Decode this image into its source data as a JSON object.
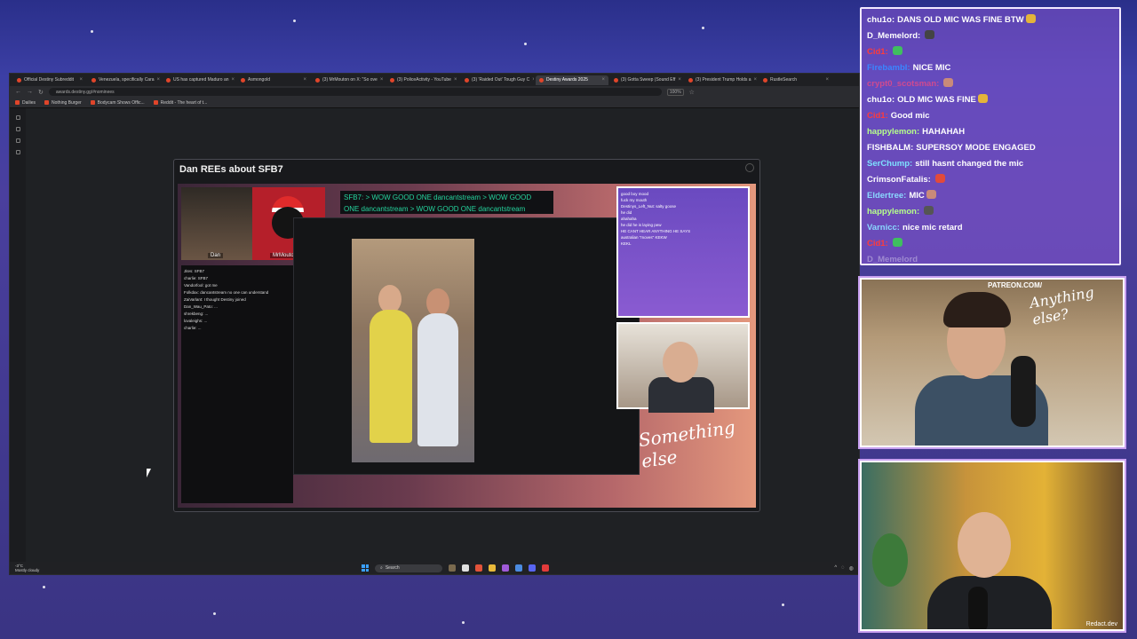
{
  "browser": {
    "tabs": [
      {
        "label": "Official Destiny Subreddit"
      },
      {
        "label": "Venezuela, specifically Cara"
      },
      {
        "label": "US has captured Maduro an"
      },
      {
        "label": "Asmongold"
      },
      {
        "label": "(3) MrMouton on X: \"So ove"
      },
      {
        "label": "(3) PoliceActivity - YouTube"
      },
      {
        "label": "(3) 'Raided Out' Tough Guy C"
      },
      {
        "label": "Destiny Awards 2025",
        "active": true
      },
      {
        "label": "(3) Gotta Sweep (Sound Eff"
      },
      {
        "label": "(3) President Trump Holds a"
      },
      {
        "label": "RustleSearch"
      }
    ],
    "url": "awards.destiny.gg/#nominees",
    "zoom": "100%",
    "bookmarks": [
      "Dailies",
      "Nothing Burger",
      "Bodycam Shows Offic...",
      "Reddit - The heart of t..."
    ]
  },
  "modal": {
    "title": "Dan REEs about SFB7",
    "video": {
      "sfb_text_1": "SFB7: > WOW GOOD ONE dancantstream > WOW GOOD",
      "sfb_text_2": "ONE dancantstream > WOW GOOD ONE dancantstream",
      "cam_label_left": "Dan",
      "cam_label_right": "MrMouton",
      "logo_text": "Something else",
      "left_chat": [
        "Jites: SFB7",
        "charlie: SFB7",
        "Vandorfool: got me",
        "Folkdax: dancantstream no one can understand",
        "ZaiVarlant: I thought Destiny joined",
        "Dan_Wau_Pato: ...",
        "shrekbeng: ...",
        "lovaleighs: ...",
        "charlie: ..."
      ],
      "right_chat": [
        "good boy mood",
        "fuck my mouth",
        "Destinys_Left_Nut: salty goose",
        "he did",
        "ahahaha",
        "he did he is laying pew",
        "HE CANT HEAR ANYTHING HE SAYS",
        "australian \"moves\" KEKW",
        "KEKL"
      ]
    }
  },
  "taskbar": {
    "weather": [
      "-3°C",
      "Mostly cloudy"
    ],
    "search_label": "Search"
  },
  "stream_chat": [
    {
      "user": "chu1o:",
      "message": "DANS OLD MIC WAS FINE BTW",
      "color": "#ffffff",
      "emote": "#e4b43a"
    },
    {
      "user": "D_Memelord:",
      "message": "",
      "color": "#ffffff",
      "emote": "#444444"
    },
    {
      "user": "Cid1:",
      "message": "",
      "color": "#ff3b3b",
      "emote": "#3fbf5f"
    },
    {
      "user": "FirebambI:",
      "message": "NICE MIC",
      "color": "#3a86ff",
      "emote": ""
    },
    {
      "user": "crypt0_scotsman:",
      "message": "",
      "color": "#d04a8f",
      "emote": "#c98a7a"
    },
    {
      "user": "chu1o:",
      "message": "OLD MIC WAS FINE",
      "color": "#ffffff",
      "emote": "#e4b43a"
    },
    {
      "user": "Cid1:",
      "message": "Good mic",
      "color": "#ff3b3b",
      "emote": ""
    },
    {
      "user": "happylemon:",
      "message": "HAHAHAH",
      "color": "#b7ff8a",
      "emote": ""
    },
    {
      "user": "FISHBALM:",
      "message": "SUPERSOY MODE ENGAGED",
      "color": "#ffffff",
      "emote": ""
    },
    {
      "user": "SerChump:",
      "message": "still hasnt changed the mic",
      "color": "#7ee0ff",
      "emote": ""
    },
    {
      "user": "CrimsonFatalis:",
      "message": "",
      "color": "#ffffff",
      "emote": "#e24a3a"
    },
    {
      "user": "Eldertree:",
      "message": "MIC",
      "color": "#8ad8ff",
      "emote": "#c98a7a"
    },
    {
      "user": "happylemon:",
      "message": "",
      "color": "#b7ff8a",
      "emote": "#555555"
    },
    {
      "user": "Varnicc:",
      "message": "nice mic retard",
      "color": "#8ad8ff",
      "emote": ""
    },
    {
      "user": "Cid1:",
      "message": "",
      "color": "#ff3b3b",
      "emote": "#3fbf5f"
    },
    {
      "user": "D_Memelord",
      "message": "",
      "color": "#ffffff",
      "emote": "",
      "faded": true
    }
  ],
  "cams": {
    "top_overlay_text": "PATREON.COM/",
    "top_overlay_script": "Anything else?",
    "bottom_credit": "Redact.dev"
  }
}
